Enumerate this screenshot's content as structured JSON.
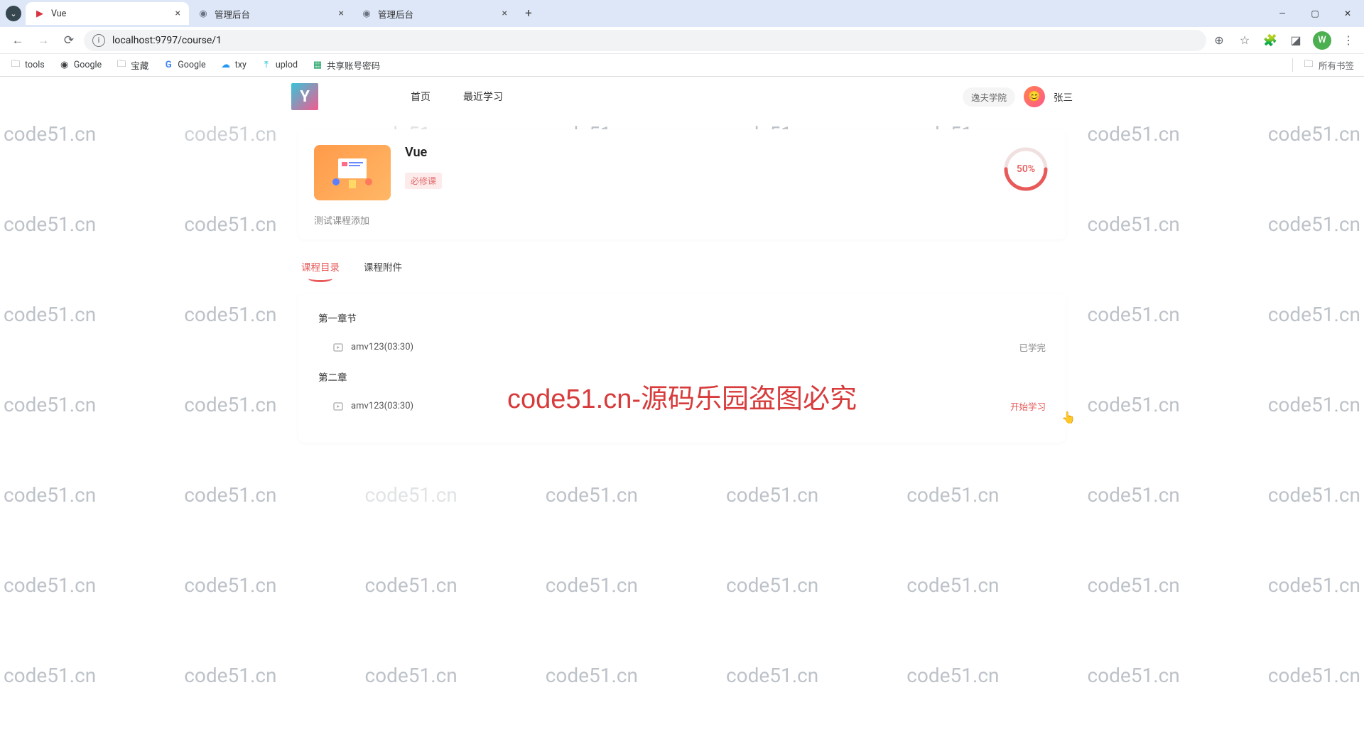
{
  "watermark_text": "code51.cn",
  "browser": {
    "tabs": [
      {
        "title": "Vue",
        "favicon": "vue",
        "active": true
      },
      {
        "title": "管理后台",
        "favicon": "globe",
        "active": false
      },
      {
        "title": "管理后台",
        "favicon": "globe",
        "active": false
      }
    ],
    "url": "localhost:9797/course/1",
    "profile_letter": "W",
    "bookmarks": [
      {
        "label": "tools",
        "type": "folder"
      },
      {
        "label": "Google",
        "type": "globe"
      },
      {
        "label": "宝藏",
        "type": "folder"
      },
      {
        "label": "Google",
        "type": "g"
      },
      {
        "label": "txy",
        "type": "cloud"
      },
      {
        "label": "uplod",
        "type": "up"
      },
      {
        "label": "共享账号密码",
        "type": "sheet"
      }
    ],
    "all_bookmarks": "所有书签"
  },
  "header": {
    "logo_text": "Y",
    "nav": [
      "首页",
      "最近学习"
    ],
    "org": "逸夫学院",
    "user_name": "张三"
  },
  "course": {
    "title": "Vue",
    "tag": "必修课",
    "desc": "测试课程添加",
    "progress": "50%",
    "progress_value": 50
  },
  "tabs": {
    "t1": "课程目录",
    "t2": "课程附件"
  },
  "chapters": [
    {
      "title": "第一章节",
      "lessons": [
        {
          "name": "amv123(03:30)",
          "status": "已学完",
          "status_type": "done"
        }
      ]
    },
    {
      "title": "第二章",
      "lessons": [
        {
          "name": "amv123(03:30)",
          "status": "开始学习",
          "status_type": "start"
        }
      ]
    }
  ],
  "overlay": "code51.cn-源码乐园盗图必究"
}
